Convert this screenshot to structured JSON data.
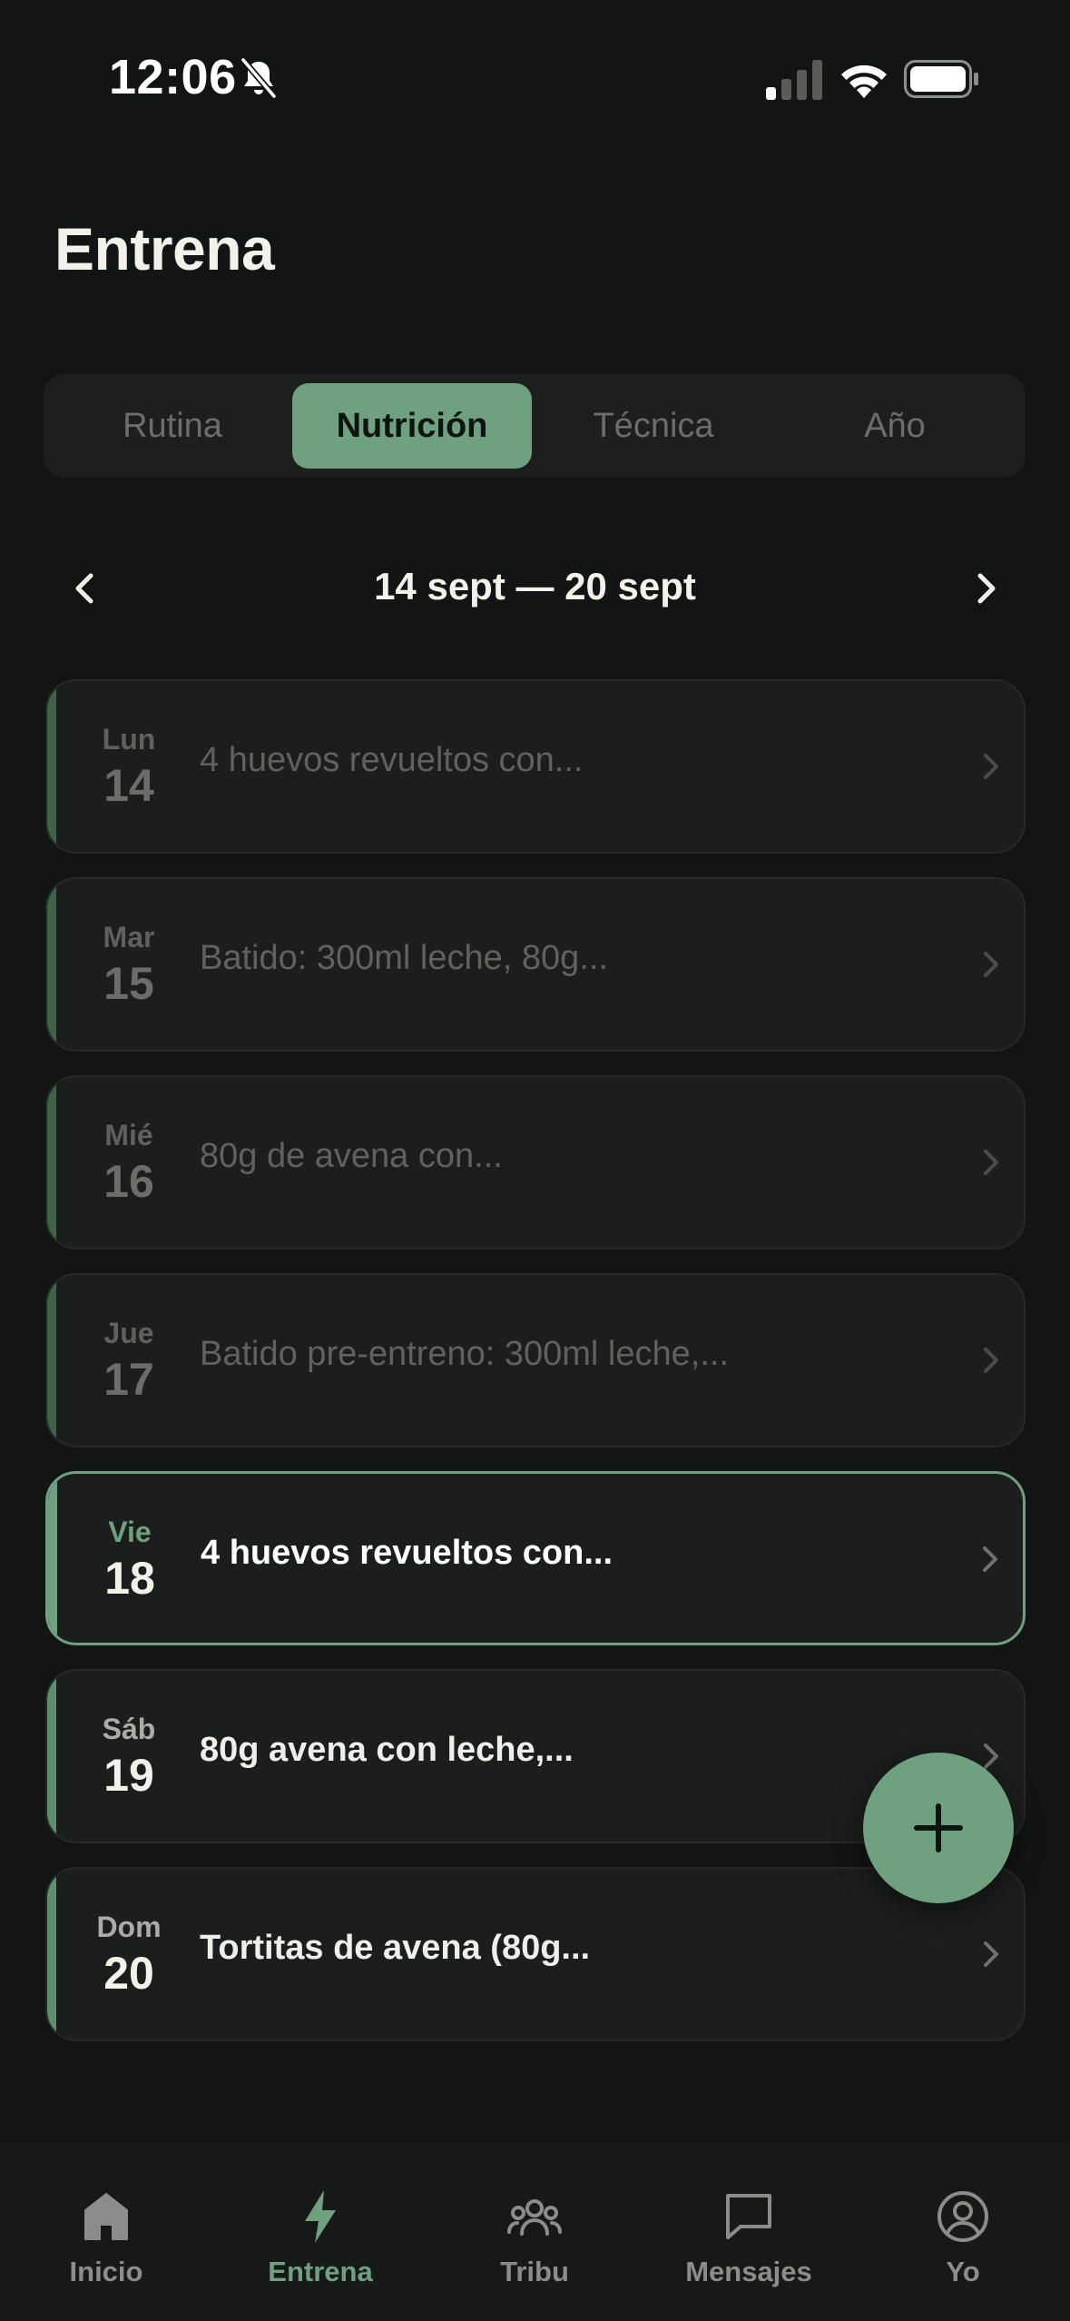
{
  "status_bar": {
    "time": "12:06"
  },
  "page": {
    "title": "Entrena"
  },
  "tabs": [
    {
      "label": "Rutina",
      "active": false
    },
    {
      "label": "Nutrición",
      "active": true
    },
    {
      "label": "Técnica",
      "active": false
    },
    {
      "label": "Año",
      "active": false
    }
  ],
  "week": {
    "label": "14 sept — 20 sept"
  },
  "days": [
    {
      "dayname": "Lun",
      "daynum": "14",
      "meal": "4 huevos revueltos con...",
      "state": "past"
    },
    {
      "dayname": "Mar",
      "daynum": "15",
      "meal": "Batido: 300ml leche, 80g...",
      "state": "past"
    },
    {
      "dayname": "Mié",
      "daynum": "16",
      "meal": "80g de avena con...",
      "state": "past"
    },
    {
      "dayname": "Jue",
      "daynum": "17",
      "meal": "Batido pre-entreno: 300ml leche,...",
      "state": "past"
    },
    {
      "dayname": "Vie",
      "daynum": "18",
      "meal": "4 huevos revueltos con...",
      "state": "selected"
    },
    {
      "dayname": "Sáb",
      "daynum": "19",
      "meal": "80g avena con leche,...",
      "state": "upcoming"
    },
    {
      "dayname": "Dom",
      "daynum": "20",
      "meal": "Tortitas de avena (80g...",
      "state": "upcoming"
    }
  ],
  "fab": {
    "icon": "plus-icon"
  },
  "bottom_nav": [
    {
      "label": "Inicio",
      "icon": "home-icon",
      "active": false
    },
    {
      "label": "Entrena",
      "icon": "bolt-icon",
      "active": true
    },
    {
      "label": "Tribu",
      "icon": "group-icon",
      "active": false
    },
    {
      "label": "Mensajes",
      "icon": "chat-icon",
      "active": false
    },
    {
      "label": "Yo",
      "icon": "profile-icon",
      "active": false
    }
  ],
  "colors": {
    "background": "#131514",
    "accent": "#6fa07f",
    "card": "#1c1e1d",
    "accent_dim": "#3c6548"
  }
}
